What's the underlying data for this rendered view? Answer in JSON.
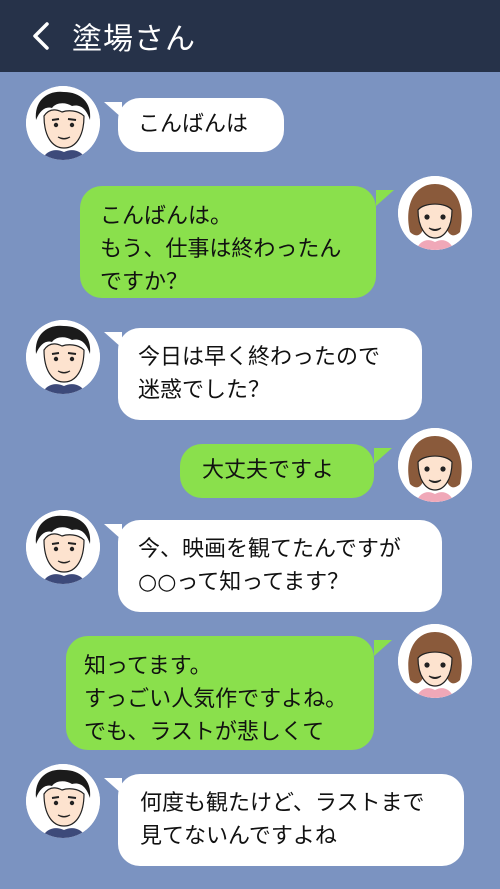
{
  "header": {
    "title": "塗場さん"
  },
  "messages": [
    {
      "side": "in",
      "lines": [
        "こんばんは"
      ]
    },
    {
      "side": "out",
      "lines": [
        "こんばんは。",
        "もう、仕事は終わったん",
        "ですか？"
      ]
    },
    {
      "side": "in",
      "lines": [
        "今日は早く終わったので",
        "迷惑でした？"
      ]
    },
    {
      "side": "out",
      "lines": [
        "大丈夫ですよ"
      ]
    },
    {
      "side": "in",
      "lines": [
        "今、映画を観てたんですが",
        "○○って知ってます？"
      ]
    },
    {
      "side": "out",
      "lines": [
        "知ってます。",
        "すっごい人気作ですよね。",
        "でも、ラストが悲しくて"
      ]
    },
    {
      "side": "in",
      "lines": [
        "何度も観たけど、ラストまで",
        "見てないんですよね"
      ]
    }
  ],
  "colors": {
    "background": "#7b93c1",
    "header": "#263249",
    "incoming_bubble": "#ffffff",
    "outgoing_bubble": "#8ae04c"
  }
}
